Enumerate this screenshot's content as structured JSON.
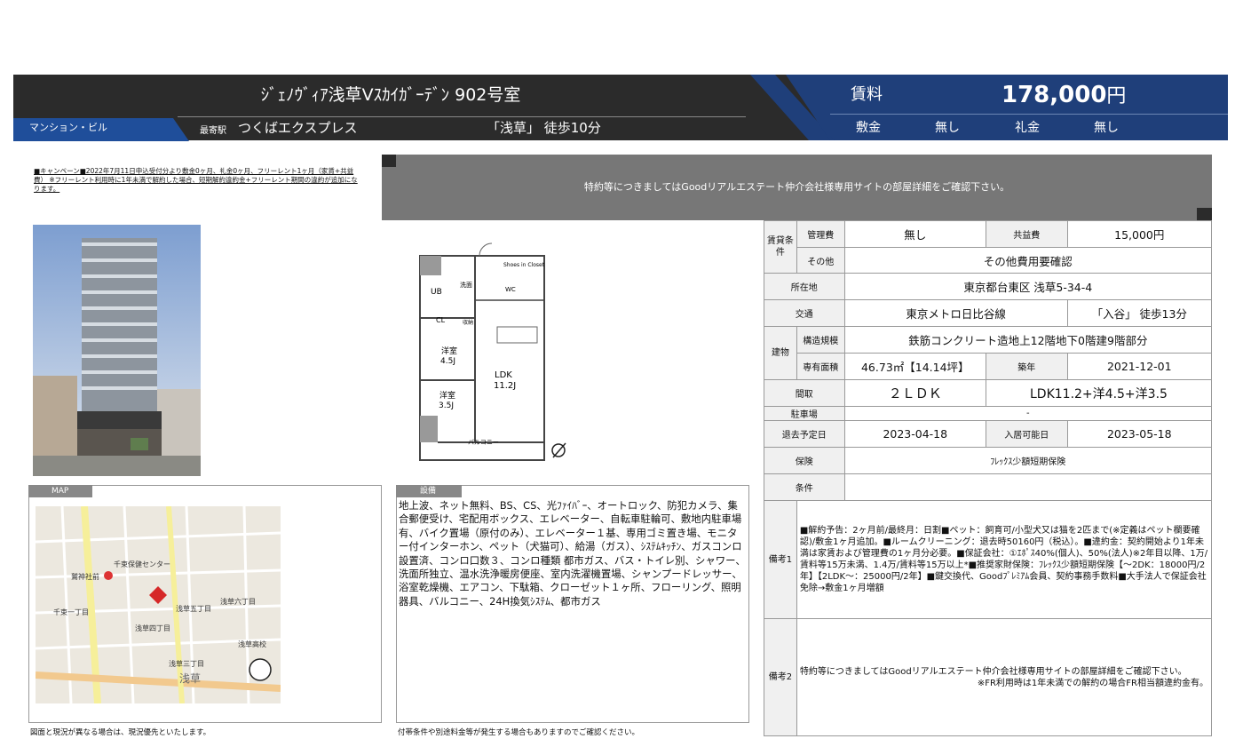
{
  "header": {
    "title": "ｼﾞｪﾉｳﾞｨｱ浅草Vｽｶｲｶﾞｰﾃﾞﾝ 902号室",
    "type_tag": "マンション・ビル",
    "nearest_label": "最寄駅",
    "station": "つくばエクスプレス",
    "walk": "「浅草」 徒歩10分",
    "rent_label": "賃料",
    "rent_value": "178,000",
    "rent_unit": "円",
    "deposit_label": "敷金",
    "deposit_value": "無し",
    "key_money_label": "礼金",
    "key_money_value": "無し"
  },
  "campaign": "■キャンペーン■2022年7月11日申込受付分より敷金0ヶ月、礼金0ヶ月、フリーレント1ヶ月（家賃+共益費） ※フリーレント利用時に1年未満で解約した場合、短期解約違約金+フリーレント期間の違約が追加になります。",
  "notice": "特約等につきましてはGoodリアルエステート仲介会社様専用サイトの部屋詳細をご確認下さい。",
  "plan": {
    "shoes": "Shoes in Closet",
    "wash": "洗面",
    "wc": "WC",
    "ub": "UB",
    "cl": "CL",
    "storage": "収納",
    "room1": "洋室",
    "room1_size": "4.5J",
    "ldk": "LDK",
    "ldk_size": "11.2J",
    "room2": "洋室",
    "room2_size": "3.5J",
    "balcony": "バルコニー"
  },
  "map": {
    "tag": "MAP",
    "note": "図面と現況が異なる場合は、現況優先といたします。",
    "labels": [
      "千束保健センター",
      "鷲神社前",
      "浅草五丁目",
      "浅草四丁目",
      "浅草高校",
      "千束一丁目",
      "浅草六丁目",
      "浅草三丁目",
      "浅草"
    ]
  },
  "facilities": {
    "tag": "設備",
    "text": "地上波、ネット無料、BS、CS、光ﾌｧｲﾊﾞｰ、オートロック、防犯カメラ、集合郵便受け、宅配用ボックス、エレベーター、自転車駐輪可、敷地内駐車場有、バイク置場（原付のみ）、エレベーター１基、専用ゴミ置き場、モニター付インターホン、ペット（犬猫可）、給湯（ガス）、ｼｽﾃﾑｷｯﾁﾝ、ガスコンロ設置済、コンロ口数３、コンロ種類 都市ガス、バス・トイレ別、シャワー、洗面所独立、温水洗浄暖房便座、室内洗濯機置場、シャンプードレッサー、浴室乾燥機、エアコン、下駄箱、クローゼット１ヶ所、フローリング、照明器具、バルコニー、24H換気ｼｽﾃﾑ、都市ガス",
    "note": "付帯条件や別途料金等が発生する場合もありますのでご確認ください。"
  },
  "table": {
    "rent_cond_label": "賃貸条件",
    "mgmt_label": "管理費",
    "mgmt_value": "無し",
    "common_label": "共益費",
    "common_value": "15,000円",
    "other_label": "その他",
    "other_value": "その他費用要確認",
    "address_label": "所在地",
    "address_value": "東京都台東区 浅草5-34-4",
    "transport_label": "交通",
    "transport_line": "東京メトロ日比谷線",
    "transport_walk": "「入谷」 徒歩13分",
    "building_label": "建物",
    "structure_label": "構造規模",
    "structure_value": "鉄筋コンクリート造地上12階地下0階建9階部分",
    "area_label": "専有面積",
    "area_value": "46.73㎡【14.14坪】",
    "built_label": "築年",
    "built_value": "2021-12-01",
    "layout_label": "間取",
    "layout_type": "２ＬＤＫ",
    "layout_detail": "LDK11.2+洋4.5+洋3.5",
    "parking_label": "駐車場",
    "parking_value": "-",
    "moveout_label": "退去予定日",
    "moveout_value": "2023-04-18",
    "movein_label": "入居可能日",
    "movein_value": "2023-05-18",
    "insurance_label": "保険",
    "insurance_value": "ﾌﾚｯｸｽ少額短期保険",
    "conditions_label": "条件",
    "conditions_value": "",
    "remarks1_label": "備考1",
    "remarks1_text": "■解約予告：2ヶ月前/最終月：日割■ペット：飼育可/小型犬又は猫を2匹まで(※定義はペット欄要確認)/敷金1ヶ月追加。■ルームクリーニング：退去時50160円（税込）。■違約金：契約開始より1年未満は家賃および管理費の1ヶ月分必要。■保証会社：①ｴﾎﾟｽ40%(個人)、50%(法人)※2年目以降、1万/賃料等15万未満、1.4万/賃料等15万以上*■推奨家財保険：ﾌﾚｯｸｽ少額短期保険【～2DK：18000円/2年】【2LDK～：25000円/2年】■鍵交換代、Goodﾌﾟﾚﾐｱﾑ会員、契約事務手数料■大手法人で保証会社免除→敷金1ヶ月増額",
    "remarks2_label": "備考2",
    "remarks2_text": "特約等につきましてはGoodリアルエステート仲介会社様専用サイトの部屋詳細をご確認下さい。",
    "remarks2_note": "※FR利用時は1年未満での解約の場合FR相当額違約金有。"
  }
}
